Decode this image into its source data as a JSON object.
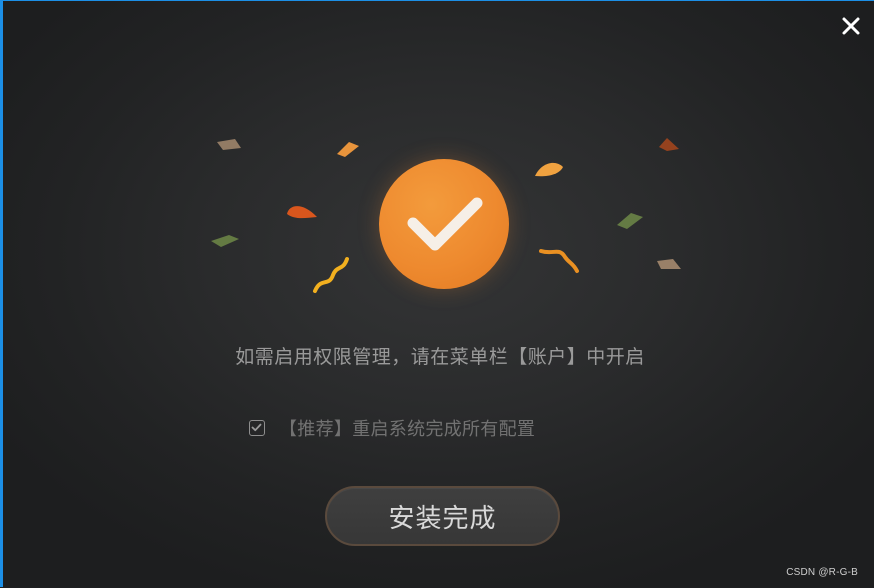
{
  "window": {
    "close_label": "✕"
  },
  "dialog": {
    "message": "如需启用权限管理，请在菜单栏【账户】中开启",
    "option": {
      "checked": true,
      "label": "【推荐】重启系统完成所有配置"
    },
    "finish_button_label": "安装完成"
  },
  "watermark": "CSDN @R-G-B",
  "colors": {
    "accent_border": "#1c8fe6",
    "badge_orange": "#ee8a2f",
    "background": "#2a2b2c",
    "button_border": "#5a4a3d"
  },
  "icons": {
    "close": "close-icon",
    "success": "check-icon",
    "checkbox": "checkbox-checked-icon"
  }
}
